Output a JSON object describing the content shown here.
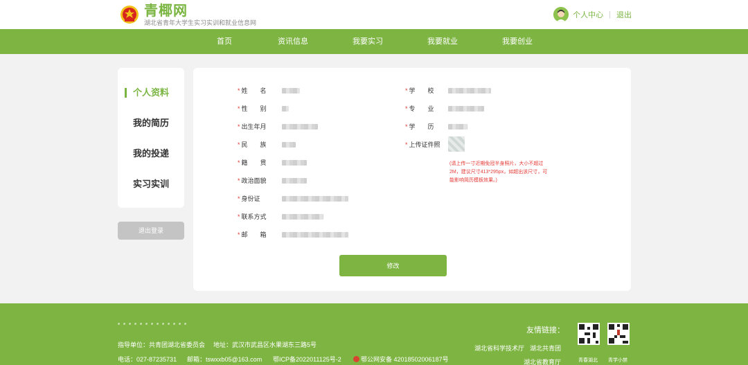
{
  "brand": {
    "name": "青椰网",
    "subtitle": "湖北省青年大学生实习实训和就业信息网",
    "color": "#7ab541"
  },
  "header": {
    "user_center": "个人中心",
    "separator": "|",
    "logout": "退出"
  },
  "nav": {
    "items": [
      "首页",
      "资讯信息",
      "我要实习",
      "我要就业",
      "我要创业"
    ]
  },
  "sidebar": {
    "items": [
      {
        "label": "个人资料",
        "active": true
      },
      {
        "label": "我的简历",
        "active": false
      },
      {
        "label": "我的投递",
        "active": false
      },
      {
        "label": "实习实训",
        "active": false
      }
    ],
    "logout_button": "退出登录"
  },
  "form": {
    "required_mark": "*",
    "left_fields": [
      "姓　　名",
      "性　　别",
      "出生年月",
      "民　　族",
      "籍　　贯",
      "政治面貌",
      "身份证",
      "联系方式",
      "邮　　箱"
    ],
    "right_fields": [
      "学　　校",
      "专　　业",
      "学　　历",
      "上传证件照"
    ],
    "upload_hint": "(请上传一寸近期免冠半身照片，大小不超过2M，建议尺寸413*295px，如超出该尺寸，可能影响简历模板效果。)",
    "submit_label": "修改"
  },
  "footer": {
    "sponsor_label": "指导单位：",
    "sponsor": "共青团湖北省委员会",
    "address_label": "地址：",
    "address": "武汉市武昌区水果湖东三路5号",
    "phone_label": "电话：",
    "phone": "027-87235731",
    "email_label": "邮箱：",
    "email": "tswxxb05@163.com",
    "icp": "鄂ICP备2022011125号-2",
    "police": "鄂公网安备 42018502006187号",
    "links_title": "友情链接：",
    "links": [
      "湖北省科学技术厅",
      "湖北共青团",
      "湖北省教育厅"
    ],
    "qr_codes": [
      "青春湖北",
      "青学小禁"
    ]
  },
  "colors": {
    "primary": "#7db442",
    "required": "#e53935",
    "page_bg": "#f2f2f2"
  }
}
